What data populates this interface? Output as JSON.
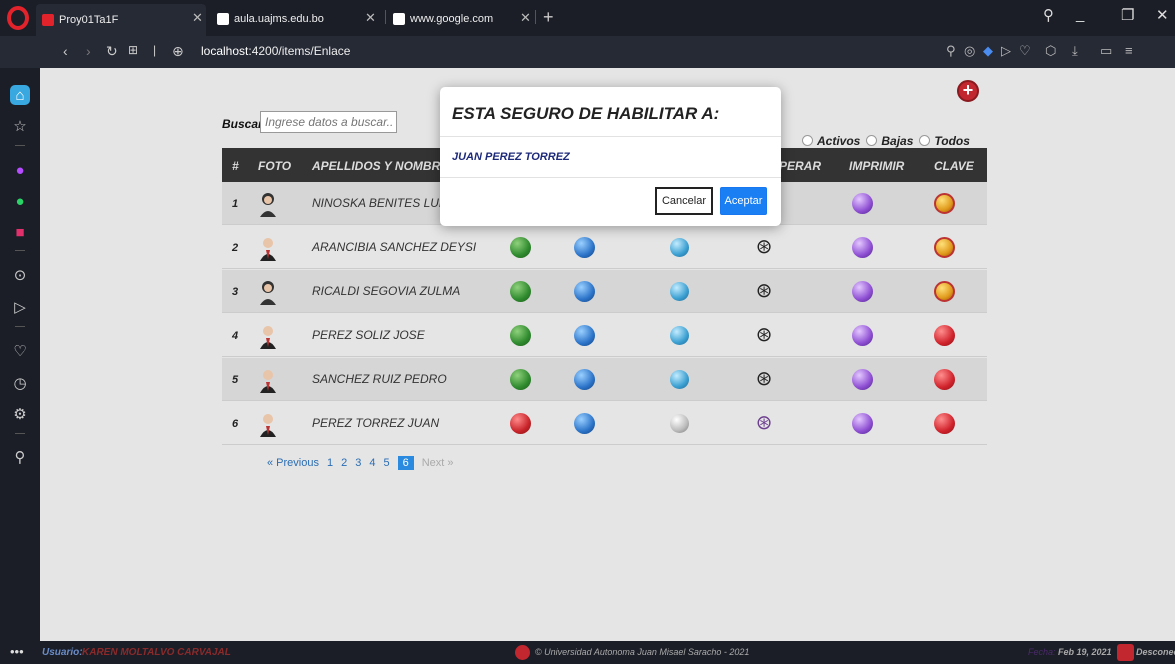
{
  "browser": {
    "tabs": [
      {
        "label": "Proy01Ta1F",
        "color": "#e2232b"
      },
      {
        "label": "aula.uajms.edu.bo"
      },
      {
        "label": "www.google.com"
      }
    ],
    "url_host": "localhost",
    "url_path": ":4200/items/Enlace"
  },
  "search": {
    "label": "Buscar",
    "placeholder": "Ingrese datos a buscar..."
  },
  "filters": {
    "activos": "Activos",
    "bajas": "Bajas",
    "todos": "Todos"
  },
  "table": {
    "headers": {
      "num": "#",
      "foto": "FOTO",
      "nombres": "APELLIDOS Y NOMBRES",
      "recuperar": "PERAR",
      "imprimir": "IMPRIMIR",
      "clave": "CLAVE"
    },
    "rows": [
      {
        "num": "1",
        "name": "NINOSKA BENITES LUDN"
      },
      {
        "num": "2",
        "name": "ARANCIBIA SANCHEZ DEYSI"
      },
      {
        "num": "3",
        "name": "RICALDI SEGOVIA ZULMA"
      },
      {
        "num": "4",
        "name": "PEREZ SOLIZ JOSE"
      },
      {
        "num": "5",
        "name": "SANCHEZ RUIZ PEDRO"
      },
      {
        "num": "6",
        "name": "PEREZ TORREZ JUAN"
      }
    ]
  },
  "pagination": {
    "previous": "« Previous",
    "pages": [
      "1",
      "2",
      "3",
      "4",
      "5",
      "6"
    ],
    "current": "6",
    "next": "Next »"
  },
  "modal": {
    "title": "ESTA SEGURO DE HABILITAR A:",
    "name": "JUAN PEREZ TORREZ",
    "cancel": "Cancelar",
    "accept": "Aceptar"
  },
  "status": {
    "user_label": "Usuario:",
    "user_name": "KAREN MOLTALVO CARVAJAL",
    "copyright": "© Universidad Autonoma Juan Misael Saracho - 2021",
    "date_label": "Fecha:",
    "date": "Feb 19, 2021",
    "disconnect": "Desconecta"
  },
  "accent": "#1a7ff2"
}
